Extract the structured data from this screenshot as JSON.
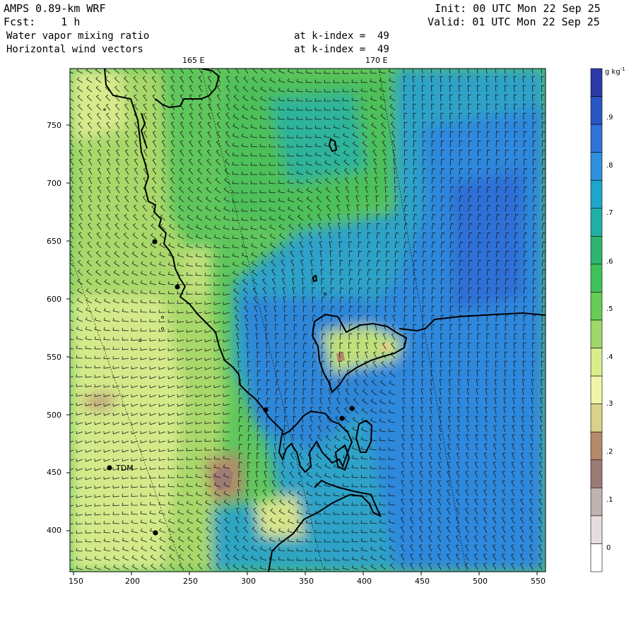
{
  "header": {
    "model": "AMPS 0.89-km WRF",
    "init": "Init: 00 UTC Mon 22 Sep 25",
    "fcst": "Fcst:    1 h",
    "valid": "Valid: 01 UTC Mon 22 Sep 25",
    "field1": "Water vapor mixing ratio",
    "field1_level": "at k-index =  49",
    "field2": "Horizontal wind vectors",
    "field2_level": "at k-index =  49"
  },
  "longitude_labels": [
    "165 E",
    "170 E"
  ],
  "x_ticks": [
    "150",
    "200",
    "250",
    "300",
    "350",
    "400",
    "450",
    "500",
    "550"
  ],
  "y_ticks": [
    "750",
    "700",
    "650",
    "600",
    "550",
    "500",
    "450",
    "400"
  ],
  "station_label": "TDM",
  "colorbar": {
    "unit": "g kg",
    "unit_sup": "-1",
    "labels": [
      ".9",
      ".8",
      ".7",
      ".6",
      ".5",
      ".4",
      ".3",
      ".2",
      ".1",
      "0"
    ],
    "colors": [
      "#2b3aa6",
      "#2a55c4",
      "#2f74d8",
      "#2f90e0",
      "#1fa5c9",
      "#20b0a8",
      "#2eb46e",
      "#3ec25a",
      "#66cc55",
      "#9fd86a",
      "#d9ee8a",
      "#f0f5a8",
      "#d9d28a",
      "#b48a6a",
      "#9a7a74",
      "#c0b2b0",
      "#e6dede",
      "#ffffff"
    ],
    "levels": [
      0.95,
      0.9,
      0.85,
      0.8,
      0.75,
      0.7,
      0.65,
      0.6,
      0.55,
      0.5,
      0.45,
      0.4,
      0.35,
      0.3,
      0.25,
      0.2,
      0.15,
      0.1
    ]
  }
}
